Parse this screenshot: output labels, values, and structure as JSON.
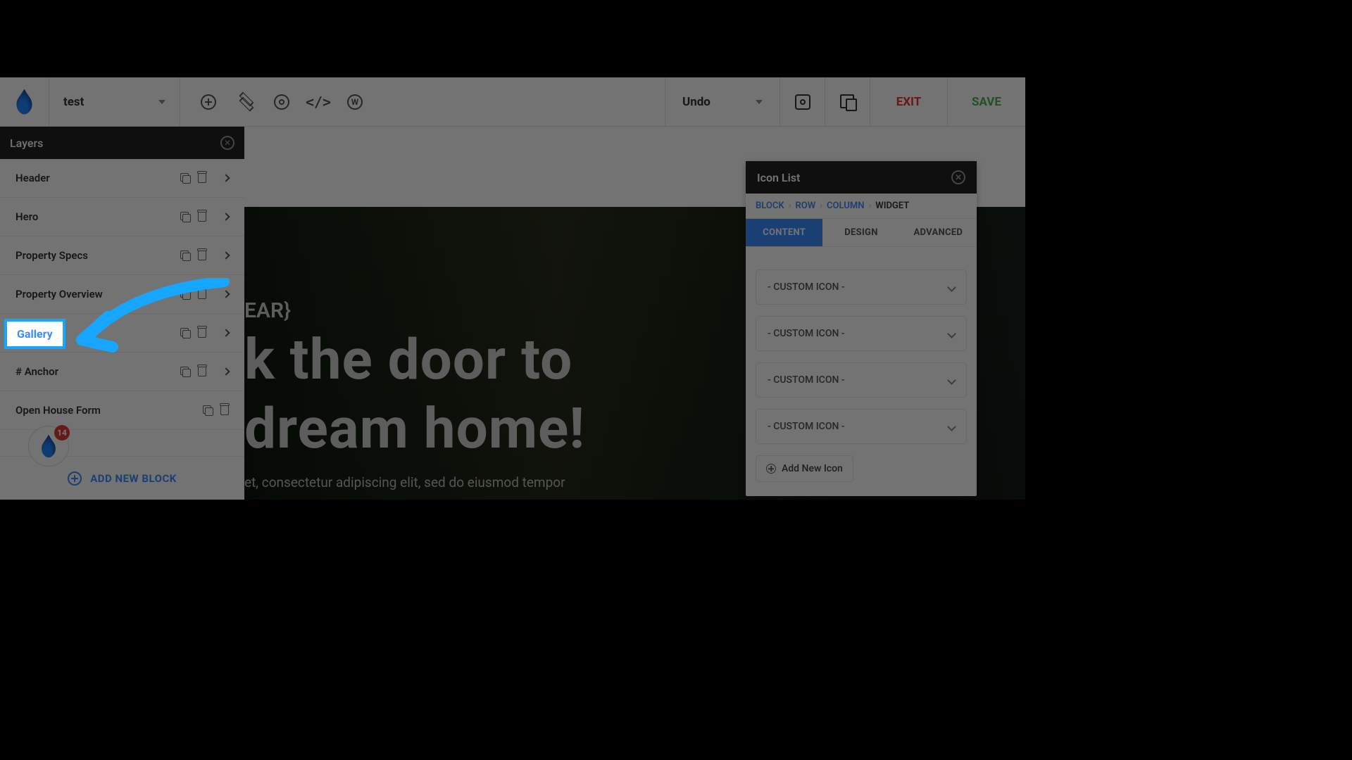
{
  "topbar": {
    "page_name": "test",
    "undo_label": "Undo",
    "exit_label": "EXIT",
    "save_label": "SAVE"
  },
  "layers_panel": {
    "title": "Layers",
    "items": [
      {
        "label": "Header",
        "has_expand": true
      },
      {
        "label": "Hero",
        "has_expand": true
      },
      {
        "label": "Property Specs",
        "has_expand": true
      },
      {
        "label": "Property Overview",
        "has_expand": true
      },
      {
        "label": "Gallery",
        "has_expand": true
      },
      {
        "label": "# Anchor",
        "has_expand": true
      },
      {
        "label": "Open House Form",
        "has_expand": false
      }
    ],
    "add_block_label": "ADD NEW BLOCK",
    "badge_count": "14"
  },
  "canvas": {
    "tagline_token": "EAR}",
    "hero_line1": "k the door to",
    "hero_line2": "dream home!",
    "subtext": "et, consectetur adipiscing elit, sed do eiusmod tempor"
  },
  "inspector": {
    "title": "Icon List",
    "crumbs": {
      "block": "BLOCK",
      "row": "ROW",
      "column": "COLUMN",
      "widget": "WIDGET"
    },
    "tabs": {
      "content": "CONTENT",
      "design": "DESIGN",
      "advanced": "ADVANCED"
    },
    "items": [
      {
        "label": "- CUSTOM ICON -"
      },
      {
        "label": "- CUSTOM ICON -"
      },
      {
        "label": "- CUSTOM ICON -"
      },
      {
        "label": "- CUSTOM ICON -"
      }
    ],
    "add_icon_label": "Add New Icon"
  },
  "callout": {
    "gallery_label": "Gallery"
  }
}
